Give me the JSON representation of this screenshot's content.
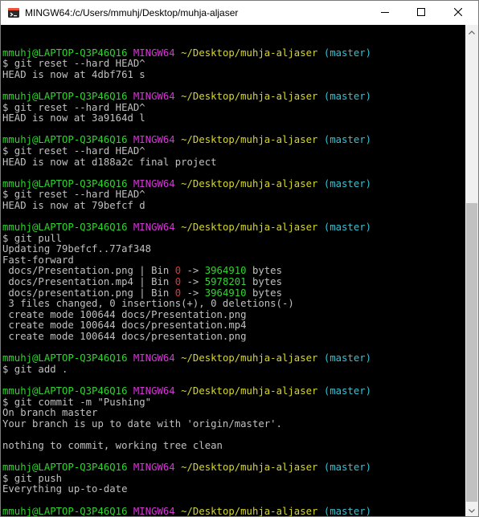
{
  "window": {
    "title": "MINGW64:/c/Users/mmuhj/Desktop/muhja-aljaser"
  },
  "icons": {
    "app": "git-bash-icon",
    "minimize": "minimize-icon",
    "maximize": "maximize-icon",
    "close": "close-icon",
    "scroll_up": "chevron-up-icon",
    "scroll_down": "chevron-down-icon"
  },
  "colors": {
    "background": "#000000",
    "text": "#c0c0c0",
    "user": "#2ed62e",
    "host": "#d638d6",
    "path": "#d6d62e",
    "branch": "#2ec4d6",
    "deleted": "#d63a3a",
    "added": "#2ed62e"
  },
  "scrollbar": {
    "scroll_position_fraction": 0.61
  },
  "terminal": {
    "lines": [
      [],
      [
        {
          "t": "mmuhj@LAPTOP-Q3P46Q16",
          "c": "user"
        },
        {
          "t": " "
        },
        {
          "t": "MINGW64",
          "c": "host"
        },
        {
          "t": " "
        },
        {
          "t": "~/Desktop/muhja-aljaser",
          "c": "path"
        },
        {
          "t": " "
        },
        {
          "t": "(master)",
          "c": "branch"
        }
      ],
      [
        {
          "t": "$ git reset --hard HEAD^"
        }
      ],
      [
        {
          "t": "HEAD is now at 4dbf761 s"
        }
      ],
      [],
      [
        {
          "t": "mmuhj@LAPTOP-Q3P46Q16",
          "c": "user"
        },
        {
          "t": " "
        },
        {
          "t": "MINGW64",
          "c": "host"
        },
        {
          "t": " "
        },
        {
          "t": "~/Desktop/muhja-aljaser",
          "c": "path"
        },
        {
          "t": " "
        },
        {
          "t": "(master)",
          "c": "branch"
        }
      ],
      [
        {
          "t": "$ git reset --hard HEAD^"
        }
      ],
      [
        {
          "t": "HEAD is now at 3a9164d l"
        }
      ],
      [],
      [
        {
          "t": "mmuhj@LAPTOP-Q3P46Q16",
          "c": "user"
        },
        {
          "t": " "
        },
        {
          "t": "MINGW64",
          "c": "host"
        },
        {
          "t": " "
        },
        {
          "t": "~/Desktop/muhja-aljaser",
          "c": "path"
        },
        {
          "t": " "
        },
        {
          "t": "(master)",
          "c": "branch"
        }
      ],
      [
        {
          "t": "$ git reset --hard HEAD^"
        }
      ],
      [
        {
          "t": "HEAD is now at d188a2c final project"
        }
      ],
      [],
      [
        {
          "t": "mmuhj@LAPTOP-Q3P46Q16",
          "c": "user"
        },
        {
          "t": " "
        },
        {
          "t": "MINGW64",
          "c": "host"
        },
        {
          "t": " "
        },
        {
          "t": "~/Desktop/muhja-aljaser",
          "c": "path"
        },
        {
          "t": " "
        },
        {
          "t": "(master)",
          "c": "branch"
        }
      ],
      [
        {
          "t": "$ git reset --hard HEAD^"
        }
      ],
      [
        {
          "t": "HEAD is now at 79befcf d"
        }
      ],
      [],
      [
        {
          "t": "mmuhj@LAPTOP-Q3P46Q16",
          "c": "user"
        },
        {
          "t": " "
        },
        {
          "t": "MINGW64",
          "c": "host"
        },
        {
          "t": " "
        },
        {
          "t": "~/Desktop/muhja-aljaser",
          "c": "path"
        },
        {
          "t": " "
        },
        {
          "t": "(master)",
          "c": "branch"
        }
      ],
      [
        {
          "t": "$ git pull"
        }
      ],
      [
        {
          "t": "Updating 79befcf..77af348"
        }
      ],
      [
        {
          "t": "Fast-forward"
        }
      ],
      [
        {
          "t": " docs/Presentation.png | Bin "
        },
        {
          "t": "0",
          "c": "red"
        },
        {
          "t": " -> "
        },
        {
          "t": "3964910",
          "c": "green"
        },
        {
          "t": " bytes"
        }
      ],
      [
        {
          "t": " docs/Presentation.mp4 | Bin "
        },
        {
          "t": "0",
          "c": "red"
        },
        {
          "t": " -> "
        },
        {
          "t": "5978201",
          "c": "green"
        },
        {
          "t": " bytes"
        }
      ],
      [
        {
          "t": " docs/presentation.png | Bin "
        },
        {
          "t": "0",
          "c": "red"
        },
        {
          "t": " -> "
        },
        {
          "t": "3964910",
          "c": "green"
        },
        {
          "t": " bytes"
        }
      ],
      [
        {
          "t": " 3 files changed, 0 insertions(+), 0 deletions(-)"
        }
      ],
      [
        {
          "t": " create mode 100644 docs/Presentation.png"
        }
      ],
      [
        {
          "t": " create mode 100644 docs/presentation.mp4"
        }
      ],
      [
        {
          "t": " create mode 100644 docs/presentation.png"
        }
      ],
      [],
      [
        {
          "t": "mmuhj@LAPTOP-Q3P46Q16",
          "c": "user"
        },
        {
          "t": " "
        },
        {
          "t": "MINGW64",
          "c": "host"
        },
        {
          "t": " "
        },
        {
          "t": "~/Desktop/muhja-aljaser",
          "c": "path"
        },
        {
          "t": " "
        },
        {
          "t": "(master)",
          "c": "branch"
        }
      ],
      [
        {
          "t": "$ git add ."
        }
      ],
      [],
      [
        {
          "t": "mmuhj@LAPTOP-Q3P46Q16",
          "c": "user"
        },
        {
          "t": " "
        },
        {
          "t": "MINGW64",
          "c": "host"
        },
        {
          "t": " "
        },
        {
          "t": "~/Desktop/muhja-aljaser",
          "c": "path"
        },
        {
          "t": " "
        },
        {
          "t": "(master)",
          "c": "branch"
        }
      ],
      [
        {
          "t": "$ git commit -m \"Pushing\""
        }
      ],
      [
        {
          "t": "On branch master"
        }
      ],
      [
        {
          "t": "Your branch is up to date with 'origin/master'."
        }
      ],
      [],
      [
        {
          "t": "nothing to commit, working tree clean"
        }
      ],
      [],
      [
        {
          "t": "mmuhj@LAPTOP-Q3P46Q16",
          "c": "user"
        },
        {
          "t": " "
        },
        {
          "t": "MINGW64",
          "c": "host"
        },
        {
          "t": " "
        },
        {
          "t": "~/Desktop/muhja-aljaser",
          "c": "path"
        },
        {
          "t": " "
        },
        {
          "t": "(master)",
          "c": "branch"
        }
      ],
      [
        {
          "t": "$ git push"
        }
      ],
      [
        {
          "t": "Everything up-to-date"
        }
      ],
      [],
      [
        {
          "t": "mmuhj@LAPTOP-Q3P46Q16",
          "c": "user"
        },
        {
          "t": " "
        },
        {
          "t": "MINGW64",
          "c": "host"
        },
        {
          "t": " "
        },
        {
          "t": "~/Desktop/muhja-aljaser",
          "c": "path"
        },
        {
          "t": " "
        },
        {
          "t": "(master)",
          "c": "branch"
        }
      ],
      [
        {
          "t": "$ "
        }
      ]
    ]
  }
}
